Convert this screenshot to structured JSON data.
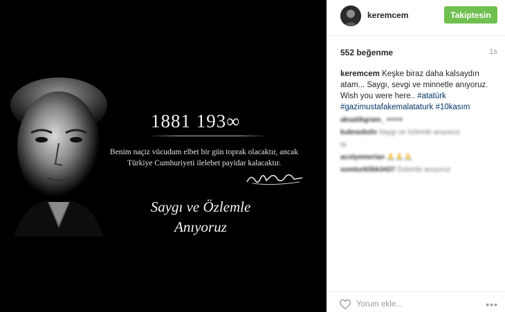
{
  "post": {
    "image": {
      "years_text": "1881 193∞",
      "quote_line1": "Benim naçiz vücudum elbet bir gün toprak olacaktır, ancak",
      "quote_line2": "Türkiye Cumhuriyeti ilelebet payidar kalacaktır.",
      "motto_line1": "Saygı ve Özlemle",
      "motto_line2": "Anıyoruz"
    },
    "header": {
      "username": "keremcem",
      "follow_label": "Takiptesin",
      "follow_color": "#70c050"
    },
    "likes": "552 beğenme",
    "time": "1s",
    "caption": {
      "username": "keremcem",
      "text": "Keşke biraz daha kalsaydın atam... Saygı, sevgi ve minnetle anıyoruz. Wish you were here..",
      "tags": [
        "#atatürk",
        "#gazimustafakemalataturk",
        "#10kasım"
      ],
      "tag_color": "#003569"
    },
    "comments": [
      {
        "user": "aksatikgram_",
        "text": "♥♥♥♥"
      },
      {
        "user": "kubrasbzln",
        "text": "Saygı ve özlemle anıyoruz"
      },
      {
        "user": "",
        "text": "ta"
      },
      {
        "user": "acolyemerian",
        "text": "🙏🙏🙏"
      },
      {
        "user": "somturklibk3437",
        "text": "Özlemle anıyoruz"
      }
    ],
    "footer": {
      "comment_placeholder": "Yorum ekle...",
      "more_label": "•••"
    }
  }
}
